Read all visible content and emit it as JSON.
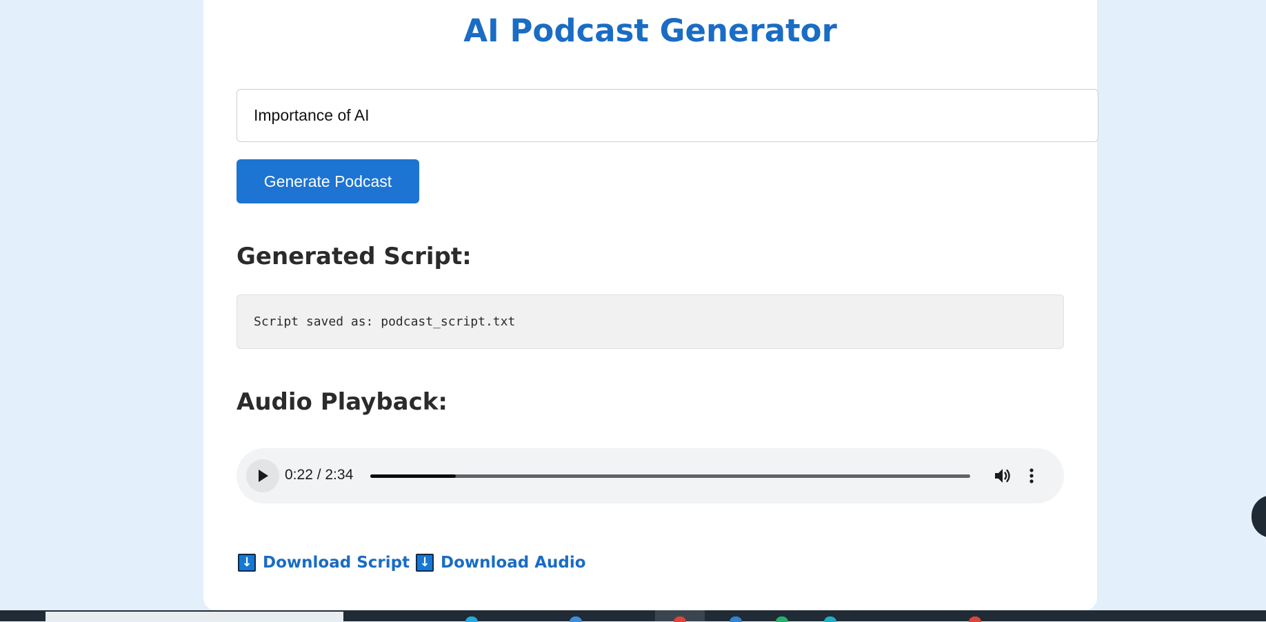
{
  "app": {
    "title": "AI Podcast Generator"
  },
  "topic": {
    "value": "Importance of AI"
  },
  "generate": {
    "label": "Generate Podcast"
  },
  "script_section": {
    "heading": "Generated Script:",
    "output": "Script saved as: podcast_script.txt"
  },
  "audio_section": {
    "heading": "Audio Playback:",
    "time": "0:22 / 2:34",
    "progress_fraction": 0.1429
  },
  "downloads": {
    "script_icon": "↓",
    "script_label": "Download Script",
    "audio_icon": "↓",
    "audio_label": "Download Audio"
  },
  "colors": {
    "accent": "#1a6cc4",
    "button": "#1d74d2",
    "page_background": "#e3f0fc"
  },
  "icons": {
    "play": "play-icon",
    "volume": "volume-icon",
    "more": "more-vertical-icon",
    "download": "download-icon"
  }
}
